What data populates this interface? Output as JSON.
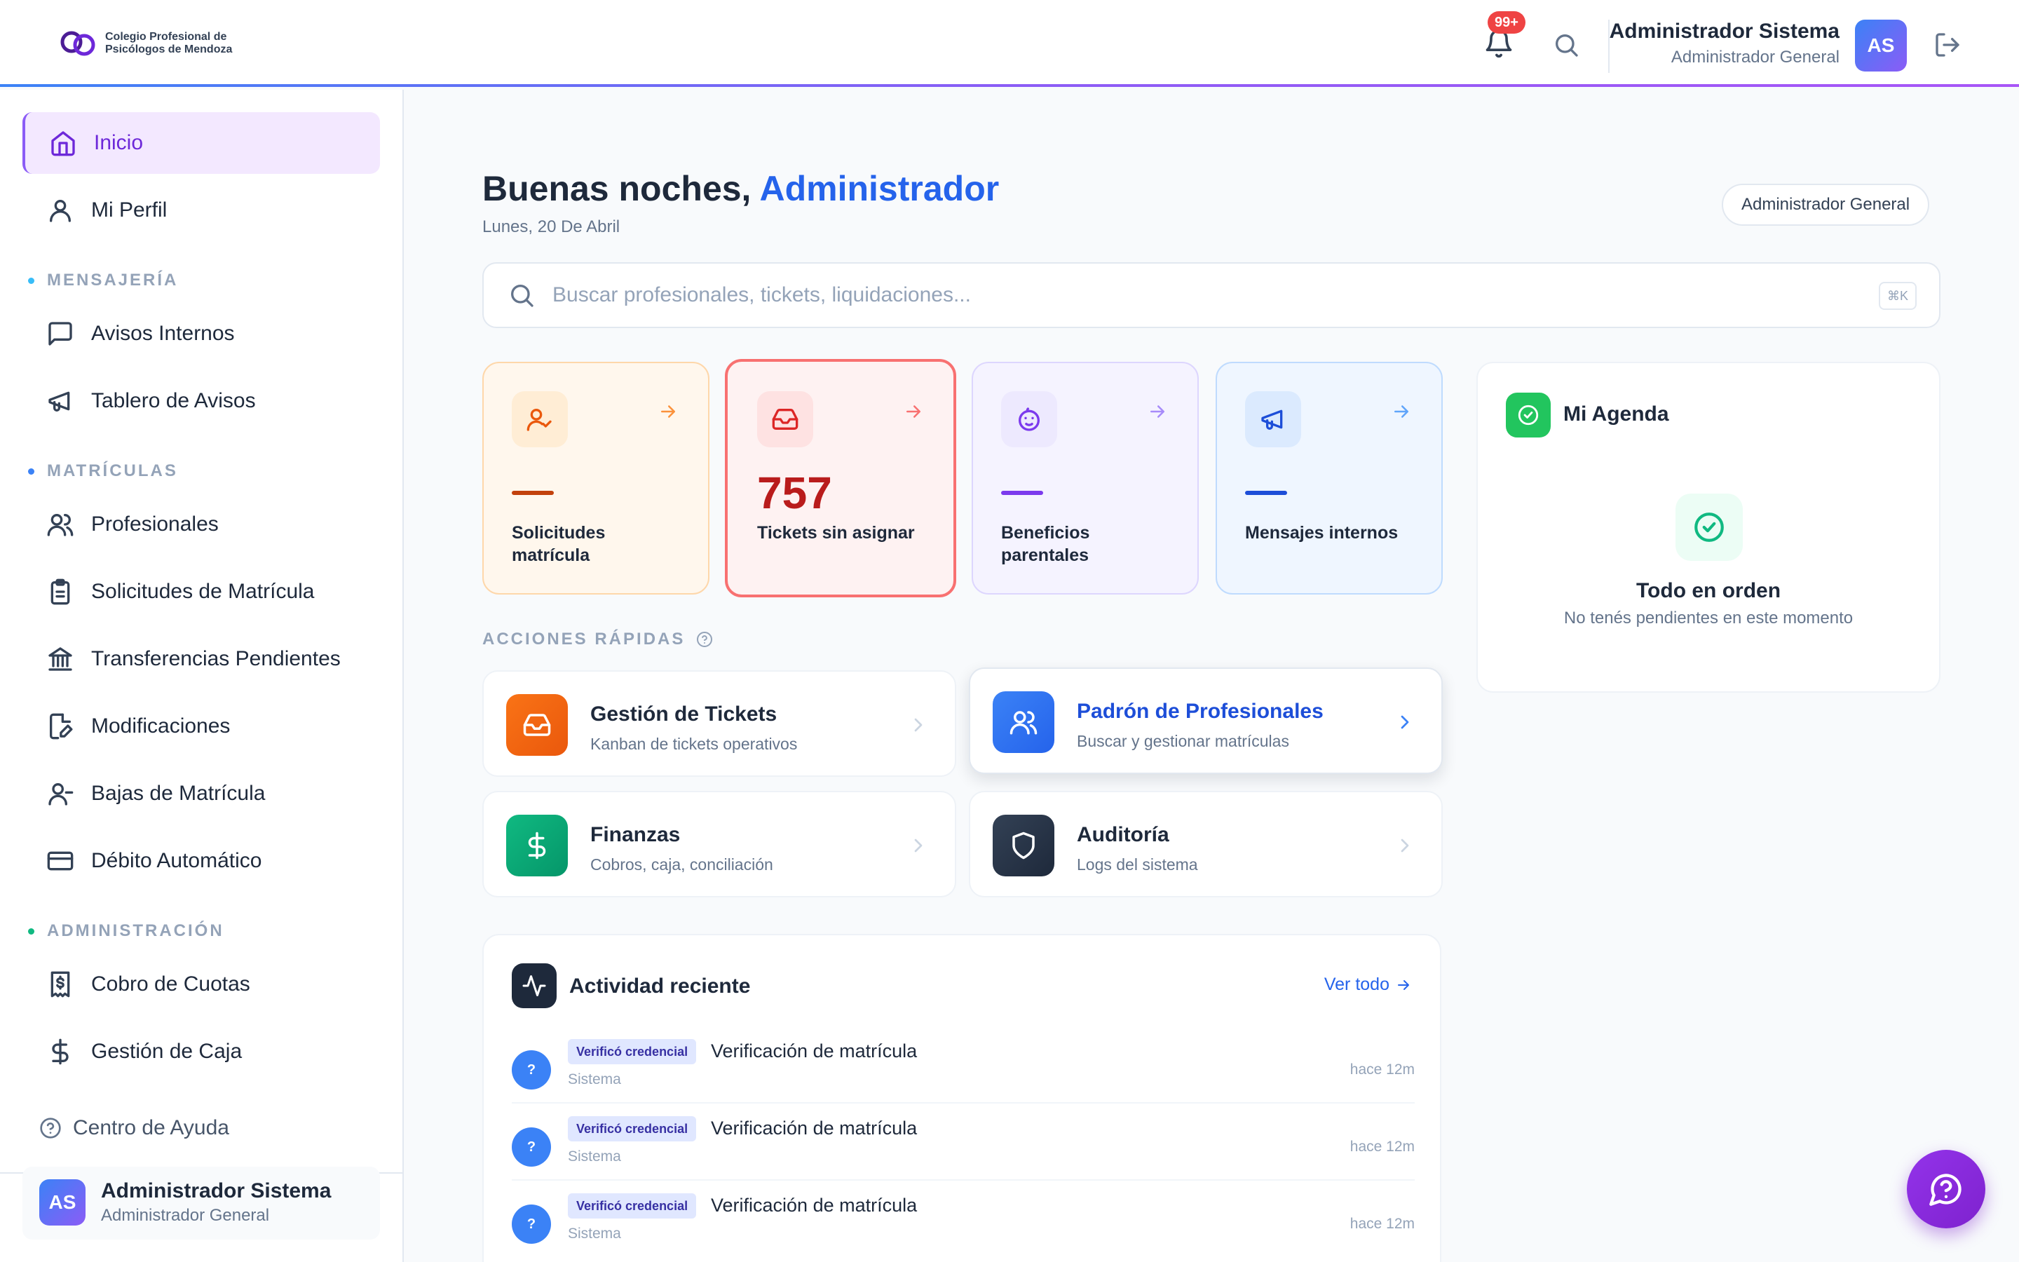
{
  "header": {
    "logo_line1": "Colegio Profesional de",
    "logo_line2": "Psicólogos de Mendoza",
    "notifications_badge": "99+",
    "user_name": "Administrador Sistema",
    "user_role": "Administrador General",
    "avatar_initials": "AS"
  },
  "sidebar": {
    "items": [
      {
        "label": "Inicio",
        "icon": "home-icon",
        "active": true
      },
      {
        "label": "Mi Perfil",
        "icon": "user-icon"
      }
    ],
    "sections": [
      {
        "title": "MENSAJERÍA",
        "color": "#38bdf8",
        "items": [
          {
            "label": "Avisos Internos",
            "icon": "message-square-icon"
          },
          {
            "label": "Tablero de Avisos",
            "icon": "megaphone-icon"
          }
        ]
      },
      {
        "title": "MATRÍCULAS",
        "color": "#3b82f6",
        "items": [
          {
            "label": "Profesionales",
            "icon": "users-icon"
          },
          {
            "label": "Solicitudes de Matrícula",
            "icon": "clipboard-icon"
          },
          {
            "label": "Transferencias Pendientes",
            "icon": "bank-icon"
          },
          {
            "label": "Modificaciones",
            "icon": "file-edit-icon"
          },
          {
            "label": "Bajas de Matrícula",
            "icon": "user-minus-icon"
          },
          {
            "label": "Débito Automático",
            "icon": "credit-card-icon"
          }
        ]
      },
      {
        "title": "ADMINISTRACIÓN",
        "color": "#10b981",
        "items": [
          {
            "label": "Cobro de Cuotas",
            "icon": "receipt-dollar-icon"
          },
          {
            "label": "Gestión de Caja",
            "icon": "dollar-icon"
          }
        ]
      }
    ],
    "help_label": "Centro de Ayuda",
    "footer_user_name": "Administrador Sistema",
    "footer_user_role": "Administrador General",
    "footer_avatar_initials": "AS"
  },
  "main": {
    "greeting_prefix": "Buenas noches,",
    "greeting_name": "Administrador",
    "date": "Lunes, 20 De Abril",
    "role_pill": "Administrador General",
    "search_placeholder": "Buscar profesionales, tickets, liquidaciones...",
    "search_shortcut": "⌘K",
    "stats": [
      {
        "label": "Solicitudes matrícula",
        "value": "",
        "icon": "user-check-icon",
        "accent": "#c2410c"
      },
      {
        "label": "Tickets sin asignar",
        "value": "757",
        "icon": "inbox-icon",
        "accent": "#dc2626"
      },
      {
        "label": "Beneficios parentales",
        "value": "",
        "icon": "baby-icon",
        "accent": "#7c3aed"
      },
      {
        "label": "Mensajes internos",
        "value": "",
        "icon": "megaphone-icon",
        "accent": "#1d4ed8"
      }
    ],
    "agenda": {
      "title": "Mi Agenda",
      "status_title": "Todo en orden",
      "status_sub": "No tenés pendientes en este momento"
    },
    "quick_actions_title": "ACCIONES RÁPIDAS",
    "quick_actions": [
      {
        "title": "Gestión de Tickets",
        "subtitle": "Kanban de tickets operativos",
        "icon": "inbox-icon",
        "color": "#ea580c"
      },
      {
        "title": "Padrón de Profesionales",
        "subtitle": "Buscar y gestionar matrículas",
        "icon": "users-icon",
        "color": "#2563eb"
      },
      {
        "title": "Finanzas",
        "subtitle": "Cobros, caja, conciliación",
        "icon": "dollar-icon",
        "color": "#059669"
      },
      {
        "title": "Auditoría",
        "subtitle": "Logs del sistema",
        "icon": "shield-icon",
        "color": "#1e293b"
      }
    ],
    "activity": {
      "title": "Actividad reciente",
      "view_all": "Ver todo",
      "rows": [
        {
          "tag": "Verificó credencial",
          "text": "Verificación de matrícula",
          "source": "Sistema",
          "time": "hace 12m",
          "avatar": "?"
        },
        {
          "tag": "Verificó credencial",
          "text": "Verificación de matrícula",
          "source": "Sistema",
          "time": "hace 12m",
          "avatar": "?"
        },
        {
          "tag": "Verificó credencial",
          "text": "Verificación de matrícula",
          "source": "Sistema",
          "time": "hace 12m",
          "avatar": "?"
        }
      ]
    }
  }
}
